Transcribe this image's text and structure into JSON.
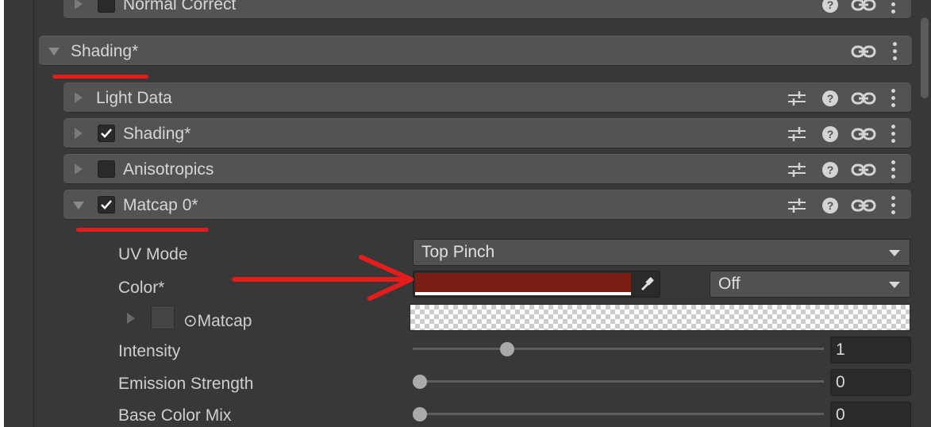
{
  "top_row": {
    "label": "Normal Correct"
  },
  "section": {
    "label": "Shading*"
  },
  "modules": [
    {
      "label": "Light Data",
      "checkbox": false,
      "checked": false,
      "expanded": false
    },
    {
      "label": "Shading*",
      "checkbox": true,
      "checked": true,
      "expanded": false
    },
    {
      "label": "Anisotropics",
      "checkbox": true,
      "checked": false,
      "expanded": false
    },
    {
      "label": "Matcap 0*",
      "checkbox": true,
      "checked": true,
      "expanded": true
    }
  ],
  "properties": {
    "uv_mode": {
      "label": "UV Mode",
      "value": "Top Pinch"
    },
    "color": {
      "label": "Color*",
      "swatch": "#7a1e14",
      "blend_mode": "Off"
    },
    "matcap": {
      "label": "⊙Matcap"
    },
    "intensity": {
      "label": "Intensity",
      "value": "1",
      "level": 0.22
    },
    "emission_strength": {
      "label": "Emission Strength",
      "value": "0",
      "level": 0
    },
    "base_color_mix": {
      "label": "Base Color Mix",
      "value": "0",
      "level": 0
    }
  },
  "icons": [
    "preset-icon",
    "help-icon",
    "link-icon",
    "kebab-menu-icon",
    "eyedropper-icon"
  ],
  "colors": {
    "panel": "#383838",
    "header": "#535353",
    "annotation": "#e51c1c"
  }
}
